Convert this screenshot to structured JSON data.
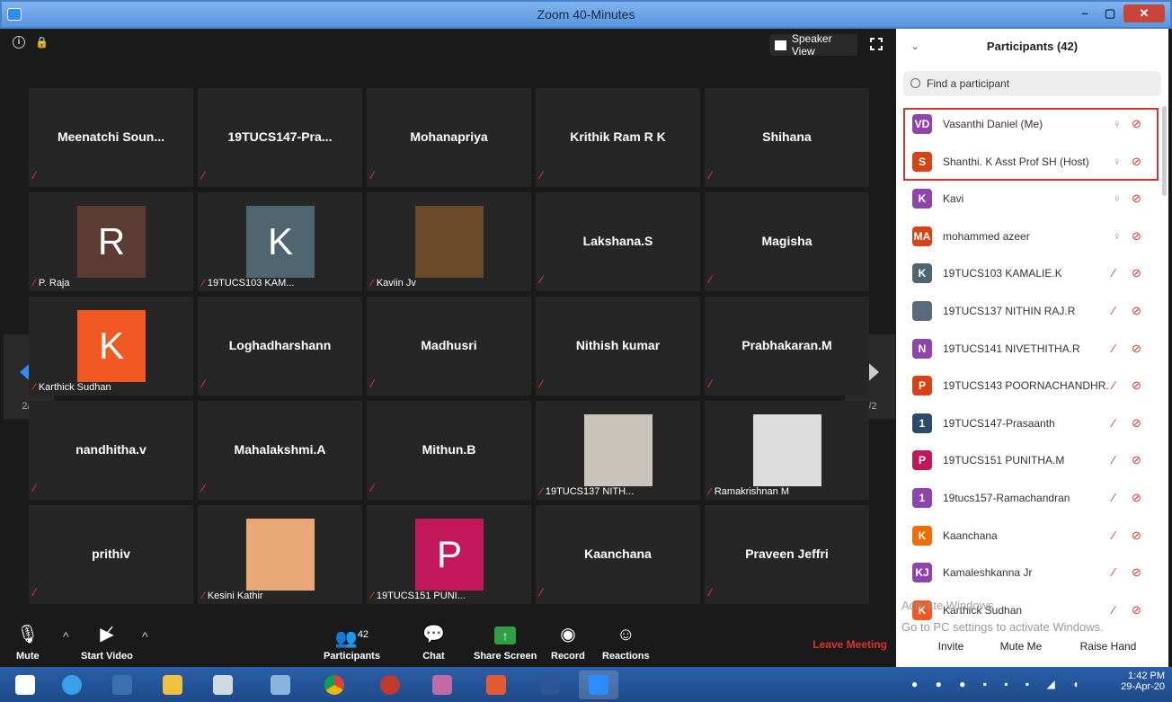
{
  "window": {
    "title": "Zoom 40-Minutes",
    "min": "–",
    "max": "▢",
    "close": "✕"
  },
  "top_bar": {
    "speaker_view": "Speaker View"
  },
  "tiles": [
    {
      "name": "Meenatchi  Soun...",
      "kind": "name"
    },
    {
      "name": "19TUCS147-Pra...",
      "kind": "name"
    },
    {
      "name": "Mohanapriya",
      "kind": "name"
    },
    {
      "name": "Krithik Ram R K",
      "kind": "name"
    },
    {
      "name": "Shihana",
      "kind": "name"
    },
    {
      "label": "P. Raja",
      "letter": "R",
      "kind": "avatar",
      "color": "#5c3b32"
    },
    {
      "label": "19TUCS103 KAM...",
      "letter": "K",
      "kind": "avatar",
      "color": "#4f6670"
    },
    {
      "label": "Kaviin Jv",
      "kind": "photo",
      "color": "#6b4a2a"
    },
    {
      "name": "Lakshana.S",
      "kind": "name"
    },
    {
      "name": "Magisha",
      "kind": "name"
    },
    {
      "label": "Karthick Sudhan",
      "letter": "K",
      "kind": "avatar",
      "color": "#f05a22"
    },
    {
      "name": "Loghadharshann",
      "kind": "name"
    },
    {
      "name": "Madhusri",
      "kind": "name"
    },
    {
      "name": "Nithish kumar",
      "kind": "name"
    },
    {
      "name": "Prabhakaran.M",
      "kind": "name"
    },
    {
      "name": "nandhitha.v",
      "kind": "name"
    },
    {
      "name": "Mahalakshmi.A",
      "kind": "name"
    },
    {
      "name": "Mithun.B",
      "kind": "name"
    },
    {
      "label": "19TUCS137 NITH...",
      "kind": "photo",
      "color": "#c9c4bc"
    },
    {
      "label": "Ramakrishnan M",
      "kind": "photo",
      "color": "#dcdcdc"
    },
    {
      "name": "prithiv",
      "kind": "name"
    },
    {
      "label": "Kesini Kathir",
      "kind": "photo",
      "color": "#e8a878"
    },
    {
      "label": "19TUCS151 PUNI...",
      "letter": "P",
      "kind": "avatar",
      "color": "#c2185b"
    },
    {
      "name": "Kaanchana",
      "kind": "name"
    },
    {
      "name": "Praveen Jeffri",
      "kind": "name"
    }
  ],
  "pager": {
    "left": "2/2",
    "right": "2/2"
  },
  "toolbar": {
    "mute": "Mute",
    "start_video": "Start Video",
    "participants": "Participants",
    "participants_count": "42",
    "chat": "Chat",
    "share_screen": "Share Screen",
    "record": "Record",
    "reactions": "Reactions",
    "leave": "Leave Meeting"
  },
  "panel": {
    "title": "Participants (42)",
    "search_placeholder": "Find a participant",
    "participants": [
      {
        "initials": "VD",
        "name": "Vasanthi Daniel (Me)",
        "color": "#8e44ad",
        "mic_muted": false
      },
      {
        "initials": "S",
        "name": "Shanthi. K Asst Prof SH (Host)",
        "color": "#d84315",
        "mic_muted": false
      },
      {
        "initials": "K",
        "name": "Kavi",
        "color": "#8e44ad",
        "mic_muted": false
      },
      {
        "initials": "MA",
        "name": "mohammed azeer",
        "color": "#d84315",
        "mic_muted": false
      },
      {
        "initials": "K",
        "name": "19TUCS103 KAMALIE.K",
        "color": "#4f6670",
        "mic_muted": true
      },
      {
        "initials": "",
        "name": "19TUCS137 NITHIN RAJ.R",
        "color": "#5a6a7a",
        "mic_muted": true
      },
      {
        "initials": "N",
        "name": "19TUCS141 NIVETHITHA.R",
        "color": "#8e44ad",
        "mic_muted": true
      },
      {
        "initials": "P",
        "name": "19TUCS143 POORNACHANDHR...",
        "color": "#d84315",
        "mic_muted": true
      },
      {
        "initials": "1",
        "name": "19TUCS147-Prasaanth",
        "color": "#2c4a6a",
        "mic_muted": true
      },
      {
        "initials": "P",
        "name": "19TUCS151 PUNITHA.M",
        "color": "#c2185b",
        "mic_muted": true
      },
      {
        "initials": "1",
        "name": "19tucs157-Ramachandran",
        "color": "#8e44ad",
        "mic_muted": true
      },
      {
        "initials": "K",
        "name": "Kaanchana",
        "color": "#ef6c00",
        "mic_muted": true
      },
      {
        "initials": "KJ",
        "name": "Kamaleshkanna Jr",
        "color": "#8e44ad",
        "mic_muted": true
      },
      {
        "initials": "K",
        "name": "Karthick Sudhan",
        "color": "#f05a22",
        "mic_muted": true
      }
    ],
    "invite": "Invite",
    "mute_me": "Mute Me",
    "raise_hand": "Raise Hand",
    "activate_line1": "Activate Windows",
    "activate_line2": "Go to PC settings to activate Windows."
  },
  "taskbar": {
    "time": "1:42 PM",
    "date": "29-Apr-20"
  }
}
